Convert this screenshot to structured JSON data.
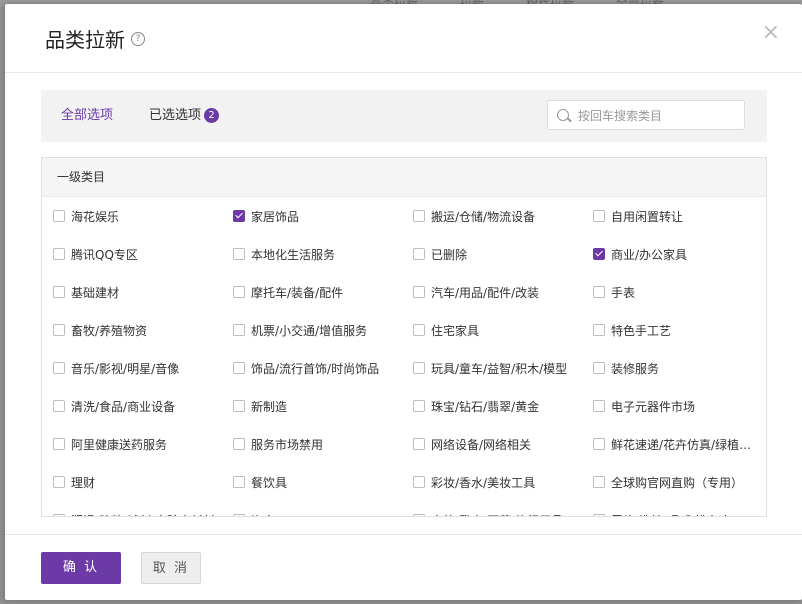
{
  "backdrop": {
    "tabs": [
      "品类拉新",
      "拉新",
      "粉丝拉新",
      "全部拉新"
    ]
  },
  "modal": {
    "title": "品类拉新",
    "help_glyph": "?",
    "close_glyph": "×"
  },
  "filter": {
    "tab_all": "全部选项",
    "tab_selected": "已选选项",
    "selected_count": "2",
    "search_placeholder": "按回车搜索类目"
  },
  "panel": {
    "header": "一级类目",
    "items": [
      {
        "label": "海花娱乐",
        "checked": false
      },
      {
        "label": "家居饰品",
        "checked": true
      },
      {
        "label": "搬运/仓储/物流设备",
        "checked": false
      },
      {
        "label": "自用闲置转让",
        "checked": false
      },
      {
        "label": "腾讯QQ专区",
        "checked": false
      },
      {
        "label": "本地化生活服务",
        "checked": false
      },
      {
        "label": "已删除",
        "checked": false
      },
      {
        "label": "商业/办公家具",
        "checked": true
      },
      {
        "label": "基础建材",
        "checked": false
      },
      {
        "label": "摩托车/装备/配件",
        "checked": false
      },
      {
        "label": "汽车/用品/配件/改装",
        "checked": false
      },
      {
        "label": "手表",
        "checked": false
      },
      {
        "label": "畜牧/养殖物资",
        "checked": false
      },
      {
        "label": "机票/小交通/增值服务",
        "checked": false
      },
      {
        "label": "住宅家具",
        "checked": false
      },
      {
        "label": "特色手工艺",
        "checked": false
      },
      {
        "label": "音乐/影视/明星/音像",
        "checked": false
      },
      {
        "label": "饰品/流行首饰/时尚饰品",
        "checked": false
      },
      {
        "label": "玩具/童车/益智/积木/模型",
        "checked": false
      },
      {
        "label": "装修服务",
        "checked": false
      },
      {
        "label": "清洗/食品/商业设备",
        "checked": false
      },
      {
        "label": "新制造",
        "checked": false
      },
      {
        "label": "珠宝/钻石/翡翠/黄金",
        "checked": false
      },
      {
        "label": "电子元器件市场",
        "checked": false
      },
      {
        "label": "阿里健康送药服务",
        "checked": false
      },
      {
        "label": "服务市场禁用",
        "checked": false
      },
      {
        "label": "网络设备/网络相关",
        "checked": false
      },
      {
        "label": "鲜花速递/花卉仿真/绿植园艺",
        "checked": false
      },
      {
        "label": "理财",
        "checked": false
      },
      {
        "label": "餐饮具",
        "checked": false
      },
      {
        "label": "彩妆/香水/美妆工具",
        "checked": false
      },
      {
        "label": "全球购官网直购（专用）",
        "checked": false
      },
      {
        "label": "润滑/胶粘/试剂/实验室耗材",
        "checked": false
      },
      {
        "label": "资产",
        "checked": false
      },
      {
        "label": "户外/登山/野营/旅行用品",
        "checked": false
      },
      {
        "label": "尿片/洗护/喂哺/推车床",
        "checked": false
      }
    ]
  },
  "footer": {
    "confirm_label": "确 认",
    "cancel_label": "取 消"
  }
}
